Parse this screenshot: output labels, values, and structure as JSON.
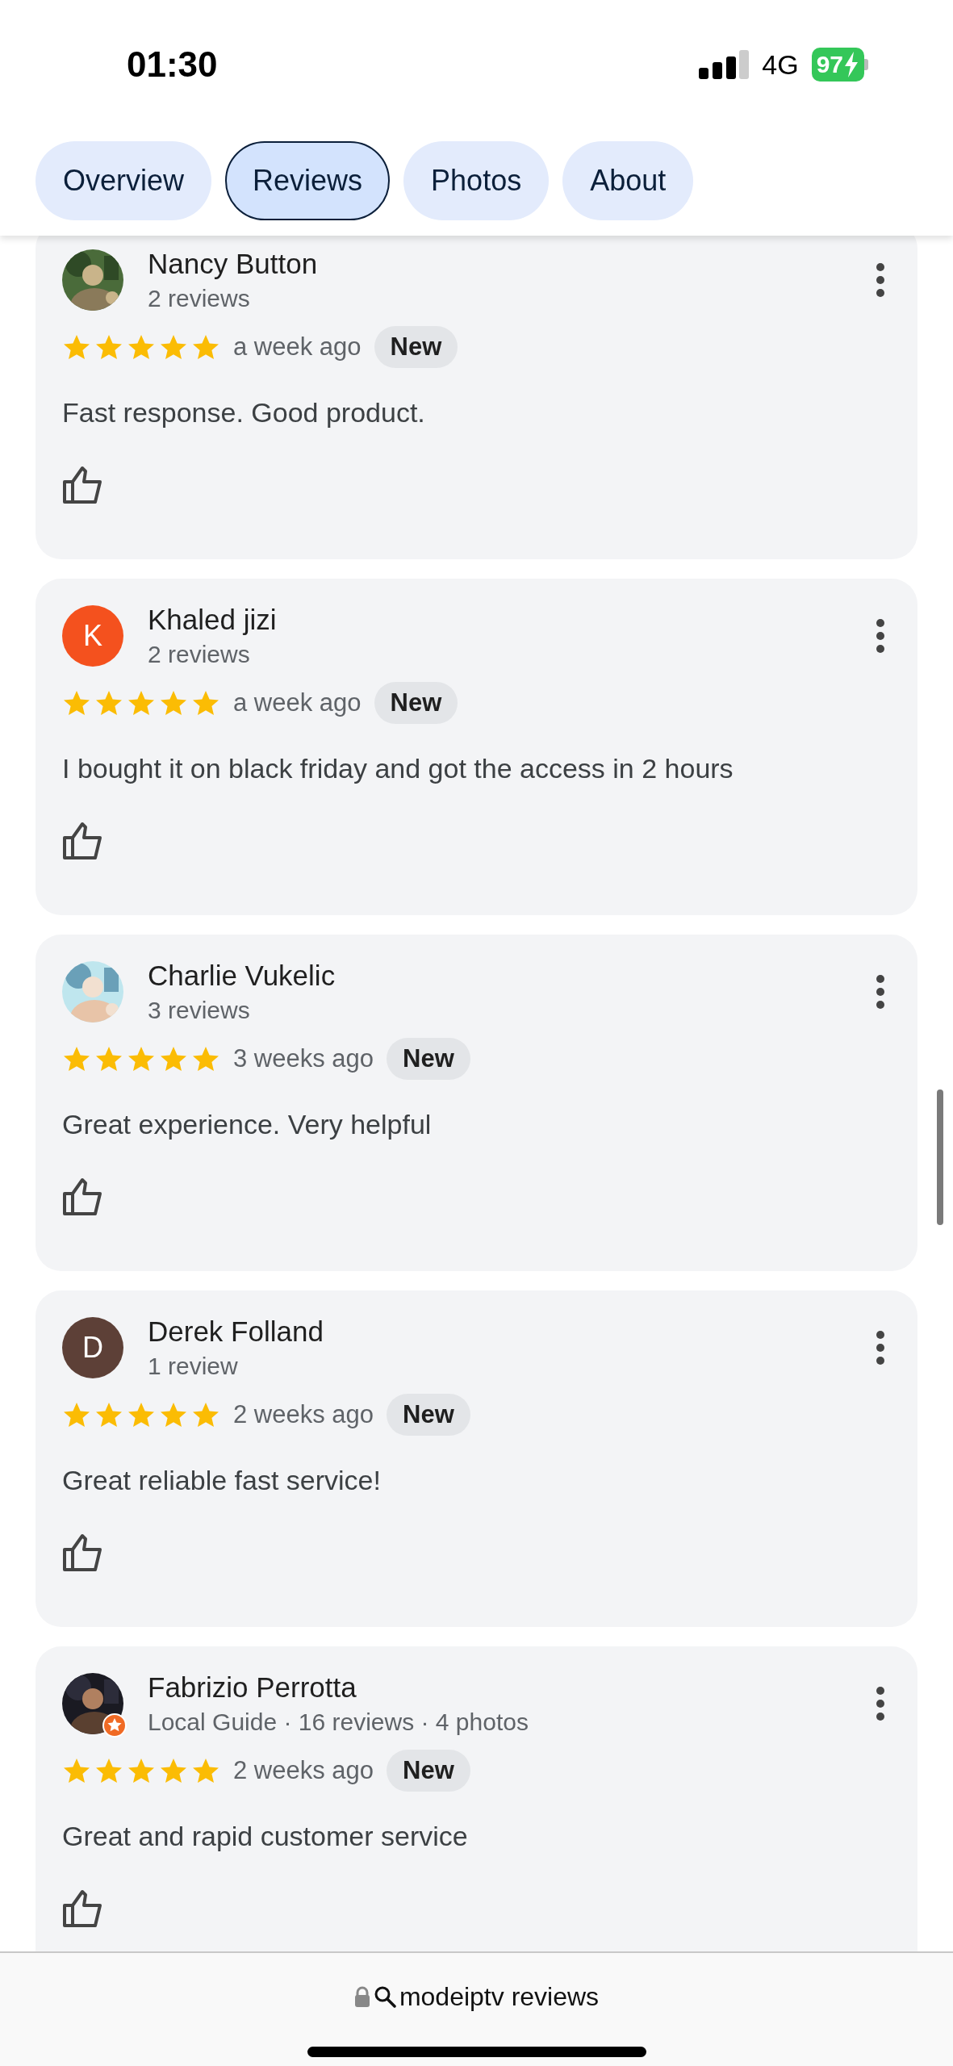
{
  "status_bar": {
    "time": "01:30",
    "network": "4G",
    "battery": "97",
    "charging": true
  },
  "tabs": [
    {
      "label": "Overview",
      "selected": false
    },
    {
      "label": "Reviews",
      "selected": true
    },
    {
      "label": "Photos",
      "selected": false
    },
    {
      "label": "About",
      "selected": false
    }
  ],
  "reviews": [
    {
      "author": "Nancy Button",
      "guide_badge": false,
      "meta": "2 reviews",
      "stars": 5,
      "time": "a week ago",
      "tag": "New",
      "text": "Fast response. Good product."
    },
    {
      "author": "Khaled jizi",
      "avatar": {
        "kind": "letter",
        "letter": "K",
        "color": "#f4511e"
      },
      "guide_badge": false,
      "meta": "2 reviews",
      "stars": 5,
      "time": "a week ago",
      "tag": "New",
      "text": "I bought it on black friday and got the access in 2 hours"
    },
    {
      "author": "Charlie Vukelic",
      "guide_badge": false,
      "meta": "3 reviews",
      "stars": 5,
      "time": "3 weeks ago",
      "tag": "New",
      "text": "Great experience. Very helpful"
    },
    {
      "author": "Derek Folland",
      "avatar": {
        "kind": "letter",
        "letter": "D",
        "color": "#5d4037"
      },
      "guide_badge": false,
      "meta": "1 review",
      "stars": 5,
      "time": "2 weeks ago",
      "tag": "New",
      "text": "Great reliable fast service!"
    },
    {
      "author": "Fabrizio Perrotta",
      "guide_badge": true,
      "meta": "Local Guide · 16 reviews · 4 photos",
      "stars": 5,
      "time": "2 weeks ago",
      "tag": "New",
      "text": "Great and rapid customer service"
    }
  ],
  "address_bar": {
    "text": "modeiptv reviews"
  }
}
